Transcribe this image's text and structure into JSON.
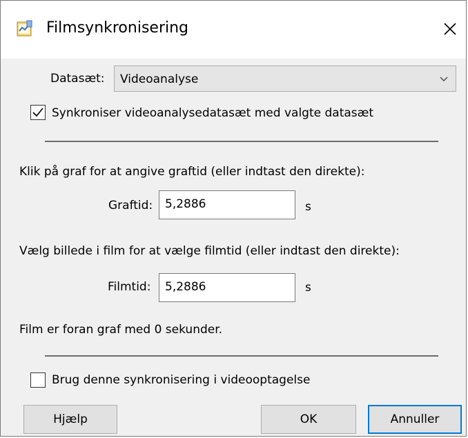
{
  "window": {
    "title": "Filmsynkronisering",
    "icon": "spreadsheet-app-icon",
    "close_icon": "close-icon"
  },
  "dataset": {
    "label": "Datasæt:",
    "selected": "Videoanalyse"
  },
  "sync_checkbox": {
    "label": "Synkroniser videoanalysedatasæt med valgte datasæt",
    "checked": true
  },
  "graph_section": {
    "instruction": "Klik på graf for at angive graftid (eller indtast den direkte):",
    "label": "Graftid:",
    "value": "5,2886",
    "unit": "s"
  },
  "film_section": {
    "instruction": "Vælg billede i film for at vælge filmtid (eller indtast den direkte):",
    "label": "Filmtid:",
    "value": "5,2886",
    "unit": "s"
  },
  "status": "Film er foran graf med 0 sekunder.",
  "record_checkbox": {
    "label": "Brug denne synkronisering i videooptagelse",
    "checked": false
  },
  "buttons": {
    "help": "Hjælp",
    "ok": "OK",
    "cancel": "Annuller"
  },
  "colors": {
    "accent": "#0078d7",
    "dialog_bg": "#f0f0f0",
    "titlebar_bg": "#ffffff"
  }
}
